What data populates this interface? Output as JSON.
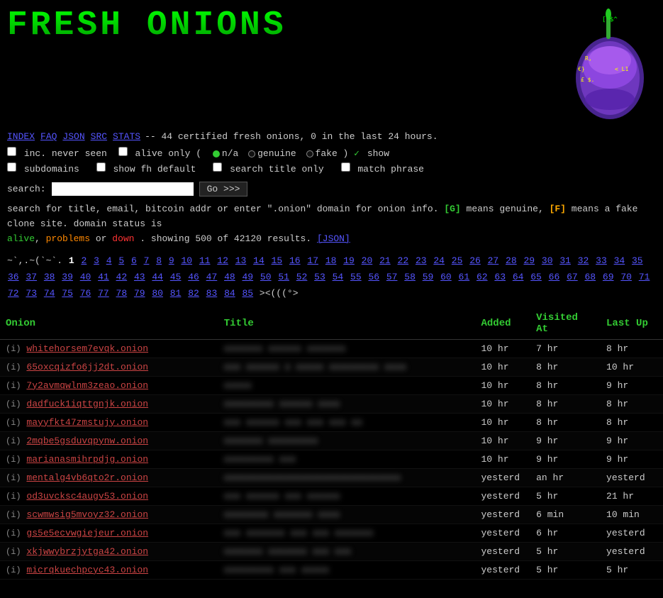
{
  "header": {
    "title": "FRESH ONIONS"
  },
  "nav": {
    "items": [
      {
        "label": "INDEX",
        "href": "#"
      },
      {
        "label": "FAQ",
        "href": "#"
      },
      {
        "label": "JSON",
        "href": "#"
      },
      {
        "label": "SRC",
        "href": "#"
      },
      {
        "label": "STATS",
        "href": "#"
      }
    ],
    "stats_text": "-- 44 certified fresh onions, 0 in the last 24 hours."
  },
  "options": {
    "inc_never_seen_label": "inc. never seen",
    "alive_only_label": "alive only (",
    "na_label": "n/a",
    "genuine_label": "genuine",
    "fake_label": "fake )",
    "show_label": "show",
    "subdomains_label": "subdomains",
    "show_fh_label": "show fh default",
    "search_title_label": "search title only",
    "match_phrase_label": "match phrase"
  },
  "search": {
    "label": "search:",
    "placeholder": "",
    "button_label": "Go >>>"
  },
  "info": {
    "text1": "search for title, email, bitcoin addr or enter \".onion\" domain for onion info.",
    "genuine_badge": "[G]",
    "genuine_desc": "means genuine,",
    "fake_badge": "[F]",
    "fake_desc": "means a fake clone site. domain status is",
    "status_alive": "alive",
    "status_comma": ",",
    "status_problems": "problems",
    "status_or": "or",
    "status_down": "down",
    "results_text": ". showing 500 of 42120 results.",
    "json_link": "[JSON]"
  },
  "pagination": {
    "tilde": "~`,.~(`~`.",
    "current": "1",
    "pages": [
      "2",
      "3",
      "4",
      "5",
      "6",
      "7",
      "8",
      "9",
      "10",
      "11",
      "12",
      "13",
      "14",
      "15",
      "16",
      "17",
      "18",
      "19",
      "20",
      "21",
      "22",
      "23",
      "24",
      "25",
      "26",
      "27",
      "28",
      "29",
      "30",
      "31",
      "32",
      "33",
      "34",
      "35",
      "36",
      "37",
      "38",
      "39",
      "40",
      "41",
      "42",
      "43",
      "44",
      "45",
      "46",
      "47",
      "48",
      "49",
      "50",
      "51",
      "52",
      "53",
      "54",
      "55",
      "56",
      "57",
      "58",
      "59",
      "60",
      "61",
      "62",
      "63",
      "64",
      "65",
      "66",
      "67",
      "68",
      "69",
      "70",
      "71",
      "72",
      "73",
      "74",
      "75",
      "76",
      "77",
      "78",
      "79",
      "80",
      "81",
      "82",
      "83",
      "84",
      "85"
    ],
    "end_symbol": "><(((°>"
  },
  "table": {
    "headers": {
      "onion": "Onion",
      "title": "Title",
      "added": "Added",
      "visited": "Visited At",
      "lastup": "Last Up"
    },
    "rows": [
      {
        "onion": "whitehorsem7evqk.onion",
        "title": "",
        "added": "10 hr",
        "visited": "7 hr",
        "lastup": "8 hr"
      },
      {
        "onion": "65oxcqizfo6jj2dt.onion",
        "title": "",
        "added": "10 hr",
        "visited": "8 hr",
        "lastup": "10 hr"
      },
      {
        "onion": "7y2avmqwlnm3zeao.onion",
        "title": "",
        "added": "10 hr",
        "visited": "8 hr",
        "lastup": "9 hr"
      },
      {
        "onion": "dadfuck1iqttgnjk.onion",
        "title": "",
        "added": "10 hr",
        "visited": "8 hr",
        "lastup": "8 hr"
      },
      {
        "onion": "mayyfkt47zmstujy.onion",
        "title": "",
        "added": "10 hr",
        "visited": "8 hr",
        "lastup": "8 hr"
      },
      {
        "onion": "2mqbe5gsduvqpynw.onion",
        "title": "",
        "added": "10 hr",
        "visited": "9 hr",
        "lastup": "9 hr"
      },
      {
        "onion": "marianasmihrpdjg.onion",
        "title": "",
        "added": "10 hr",
        "visited": "9 hr",
        "lastup": "9 hr"
      },
      {
        "onion": "mentalg4vb6qto2r.onion",
        "title": "",
        "added": "yesterd",
        "visited": "an hr",
        "lastup": "yesterd"
      },
      {
        "onion": "od3uvcksc4augv53.onion",
        "title": "",
        "added": "yesterd",
        "visited": "5 hr",
        "lastup": "21 hr"
      },
      {
        "onion": "scwmwsig5mvoyz32.onion",
        "title": "",
        "added": "yesterd",
        "visited": "6 min",
        "lastup": "10 min"
      },
      {
        "onion": "gs5e5ecvwgiejeur.onion",
        "title": "",
        "added": "yesterd",
        "visited": "6 hr",
        "lastup": "yesterd"
      },
      {
        "onion": "xkjwwybrzjytga42.onion",
        "title": "",
        "added": "yesterd",
        "visited": "5 hr",
        "lastup": "yesterd"
      },
      {
        "onion": "micrqkuechpcyc43.onion",
        "title": "",
        "added": "yesterd",
        "visited": "5 hr",
        "lastup": "5 hr"
      }
    ]
  }
}
